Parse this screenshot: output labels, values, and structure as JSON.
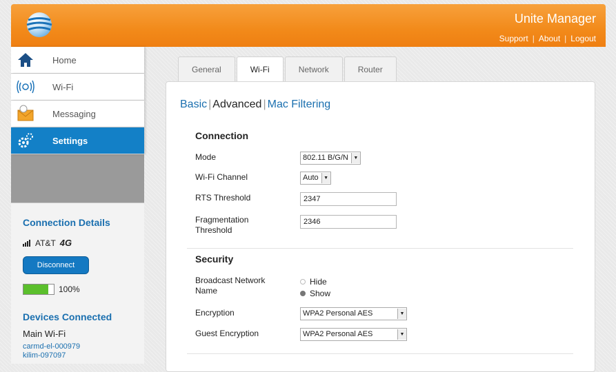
{
  "header": {
    "app_title": "Unite Manager",
    "links": [
      "Support",
      "About",
      "Logout"
    ]
  },
  "sidebar": {
    "items": [
      {
        "label": "Home",
        "icon": "home-icon"
      },
      {
        "label": "Wi-Fi",
        "icon": "wifi-icon"
      },
      {
        "label": "Messaging",
        "icon": "envelope-icon"
      },
      {
        "label": "Settings",
        "icon": "gears-icon",
        "active": true
      }
    ]
  },
  "connection": {
    "title": "Connection Details",
    "carrier": "AT&T",
    "network_badge": "4G",
    "disconnect_label": "Disconnect",
    "battery_label": "100%",
    "battery_level": 0.82,
    "devices_title": "Devices Connected",
    "main_wifi": "Main Wi-Fi",
    "devices": [
      "carmd-el-000979",
      "kilim-097097"
    ]
  },
  "tabs": [
    {
      "label": "General"
    },
    {
      "label": "Wi-Fi",
      "active": true
    },
    {
      "label": "Network"
    },
    {
      "label": "Router"
    }
  ],
  "subnav": {
    "basic": "Basic",
    "advanced": "Advanced",
    "mac_filtering": "Mac Filtering"
  },
  "connection_section": {
    "title": "Connection",
    "mode_label": "Mode",
    "mode_value": "802.11 B/G/N",
    "channel_label": "Wi-Fi Channel",
    "channel_value": "Auto",
    "rts_label": "RTS Threshold",
    "rts_value": "2347",
    "frag_label_1": "Fragmentation",
    "frag_label_2": "Threshold",
    "frag_value": "2346"
  },
  "security_section": {
    "title": "Security",
    "broadcast_label_1": "Broadcast Network",
    "broadcast_label_2": "Name",
    "hide_label": "Hide",
    "show_label": "Show",
    "encryption_label": "Encryption",
    "encryption_value": "WPA2 Personal AES",
    "guest_encryption_label": "Guest Encryption",
    "guest_encryption_value": "WPA2 Personal AES"
  },
  "colors": {
    "header_orange": "#f28a1a",
    "accent_blue": "#1380c7",
    "battery_green": "#5bbf2c"
  }
}
